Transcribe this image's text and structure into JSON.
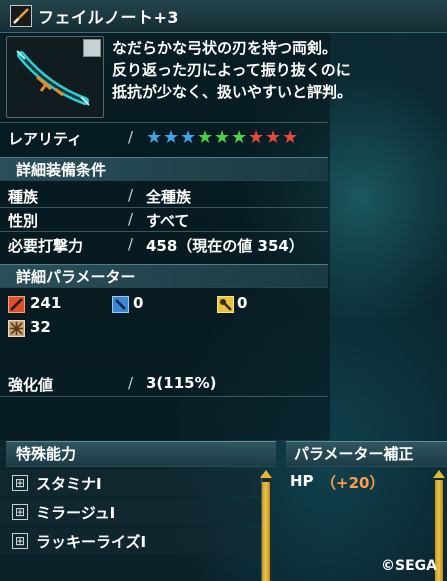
{
  "header": {
    "title": "フェイルノート+3",
    "icon": "bow-icon"
  },
  "item": {
    "image": "twin-blade-bow-image",
    "description": [
      "なだらかな弓状の刃を持つ両剣。",
      "反り返った刃によって振り抜くのに",
      "抵抗が少なく、扱いやすいと評判。"
    ]
  },
  "rarity": {
    "label": "レアリティ",
    "slash": "/",
    "stars": [
      {
        "glyph": "★",
        "color": "#3fa6e8"
      },
      {
        "glyph": "★",
        "color": "#3fa6e8"
      },
      {
        "glyph": "★",
        "color": "#3fa6e8"
      },
      {
        "glyph": "★",
        "color": "#4bd24a"
      },
      {
        "glyph": "★",
        "color": "#4bd24a"
      },
      {
        "glyph": "★",
        "color": "#4bd24a"
      },
      {
        "glyph": "★",
        "color": "#e8473a"
      },
      {
        "glyph": "★",
        "color": "#e8473a"
      },
      {
        "glyph": "★",
        "color": "#e8473a"
      }
    ]
  },
  "requirements": {
    "title": "詳細装備条件",
    "rows": [
      {
        "label": "種族",
        "slash": "/",
        "value": "全種族"
      },
      {
        "label": "性別",
        "slash": "/",
        "value": "すべて"
      },
      {
        "label": "必要打撃力",
        "slash": "/",
        "value": "458（現在の値 354）"
      }
    ]
  },
  "parameters": {
    "title": "詳細パラメーター",
    "attack": "241",
    "ranged": "0",
    "tech": "0",
    "element": "32"
  },
  "enhance": {
    "label": "強化値",
    "slash": "/",
    "value": "3(115%)"
  },
  "abilities": {
    "title": "特殊能力",
    "expand": "⊞",
    "items": [
      "スタミナI",
      "ミラージュI",
      "ラッキーライズI"
    ]
  },
  "param_bonus": {
    "title": "パラメーター補正",
    "stat": "HP",
    "value": "（+20）",
    "value_color": "#ff9b4a"
  },
  "copyright": "©SEGA"
}
